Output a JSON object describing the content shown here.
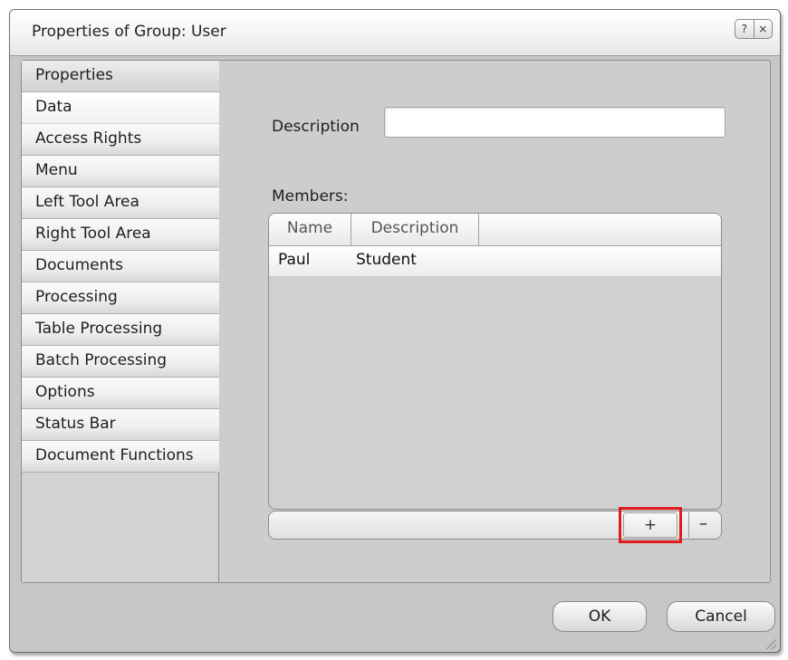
{
  "window": {
    "title": "Properties of Group: User",
    "help_button": "?",
    "close_button": "×"
  },
  "nav": {
    "items": [
      {
        "label": "Properties"
      },
      {
        "label": "Data"
      },
      {
        "label": "Access Rights"
      },
      {
        "label": "Menu"
      },
      {
        "label": "Left Tool Area"
      },
      {
        "label": "Right Tool Area"
      },
      {
        "label": "Documents"
      },
      {
        "label": "Processing"
      },
      {
        "label": "Table Processing"
      },
      {
        "label": "Batch Processing"
      },
      {
        "label": "Options"
      },
      {
        "label": "Status Bar"
      },
      {
        "label": "Document Functions"
      }
    ]
  },
  "form": {
    "description_label": "Description",
    "description_value": "",
    "members_label": "Members:"
  },
  "members": {
    "columns": [
      "Name",
      "Description"
    ],
    "rows": [
      {
        "name": "Paul",
        "description": "Student"
      }
    ],
    "add_label": "+",
    "remove_label": "–"
  },
  "buttons": {
    "ok": "OK",
    "cancel": "Cancel"
  },
  "colors": {
    "highlight": "#e01b1b"
  }
}
